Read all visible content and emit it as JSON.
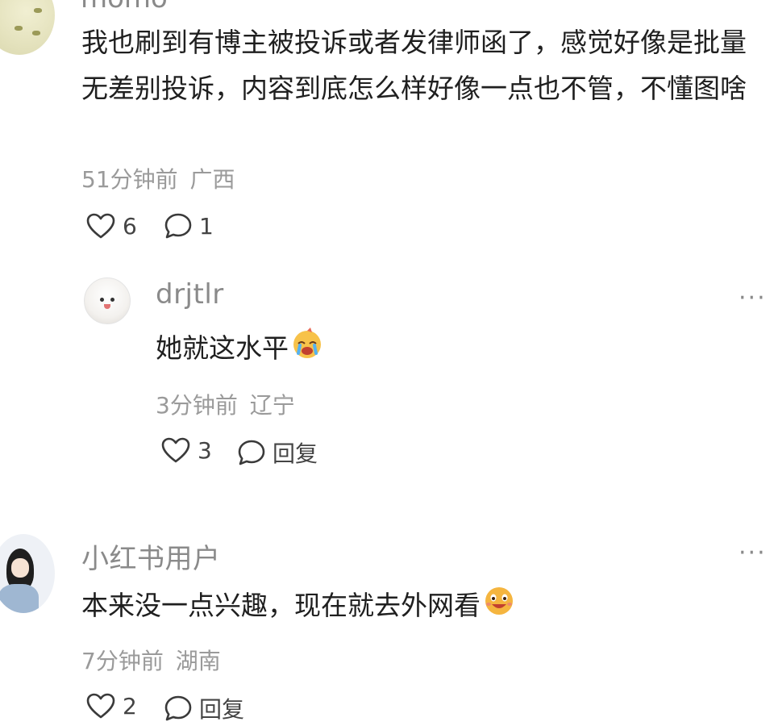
{
  "comments": [
    {
      "username": "momo",
      "text": "我也刷到有博主被投诉或者发律师函了，感觉好像是批量无差别投诉，内容到底怎么样好像一点也不管，不懂图啥",
      "time": "51分钟前",
      "location": "广西",
      "likes": "6",
      "replies": "1"
    },
    {
      "username": "drjtlr",
      "text": "她就这水平",
      "time": "3分钟前",
      "location": "辽宁",
      "likes": "3",
      "reply_label": "回复",
      "more": "···"
    },
    {
      "username": "小红书用户",
      "text": "本来没一点兴趣，现在就去外网看",
      "time": "7分钟前",
      "location": "湖南",
      "likes": "2",
      "reply_label": "回复",
      "more": "···"
    }
  ],
  "icons": {
    "like": "heart-outline-icon",
    "comment": "speech-bubble-icon",
    "emoji_cry": "crying-face-emoji",
    "emoji_grin": "grinning-face-emoji"
  }
}
